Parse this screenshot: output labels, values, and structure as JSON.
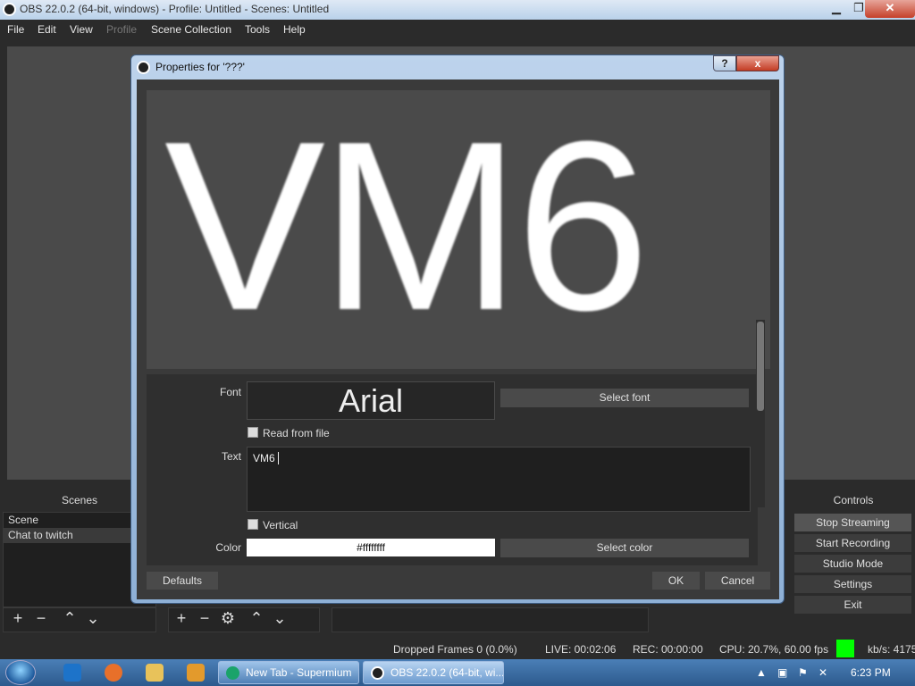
{
  "window": {
    "title": "OBS 22.0.2 (64-bit, windows) - Profile: Untitled - Scenes: Untitled"
  },
  "menu": {
    "items": [
      "File",
      "Edit",
      "View",
      "Profile",
      "Scene Collection",
      "Tools",
      "Help"
    ]
  },
  "dialog": {
    "title": "Properties for '???'",
    "preview_text": "VM6",
    "font_label": "Font",
    "font_value": "Arial",
    "select_font": "Select font",
    "read_from_file": "Read from file",
    "text_label": "Text",
    "text_value": "VM6",
    "vertical": "Vertical",
    "color_label": "Color",
    "color_value": "#ffffffff",
    "select_color": "Select color",
    "defaults": "Defaults",
    "ok": "OK",
    "cancel": "Cancel",
    "help_btn": "?",
    "close_btn": "x"
  },
  "scenes": {
    "header": "Scenes",
    "items": [
      "Scene",
      "Chat to twitch"
    ]
  },
  "controls": {
    "header": "Controls",
    "buttons": [
      "Stop Streaming",
      "Start Recording",
      "Studio Mode",
      "Settings",
      "Exit"
    ]
  },
  "status": {
    "dropped": "Dropped Frames 0 (0.0%)",
    "live": "LIVE: 00:02:06",
    "rec": "REC: 00:00:00",
    "cpu": "CPU: 20.7%, 60.00 fps",
    "kbs": "kb/s: 4175"
  },
  "taskbar": {
    "tasks": [
      "New Tab - Supermium",
      "OBS 22.0.2 (64-bit, wi..."
    ],
    "clock": "6:23 PM"
  },
  "colors": {
    "live_indicator": "#00ff00",
    "preview_bg": "#4a4a4a"
  }
}
